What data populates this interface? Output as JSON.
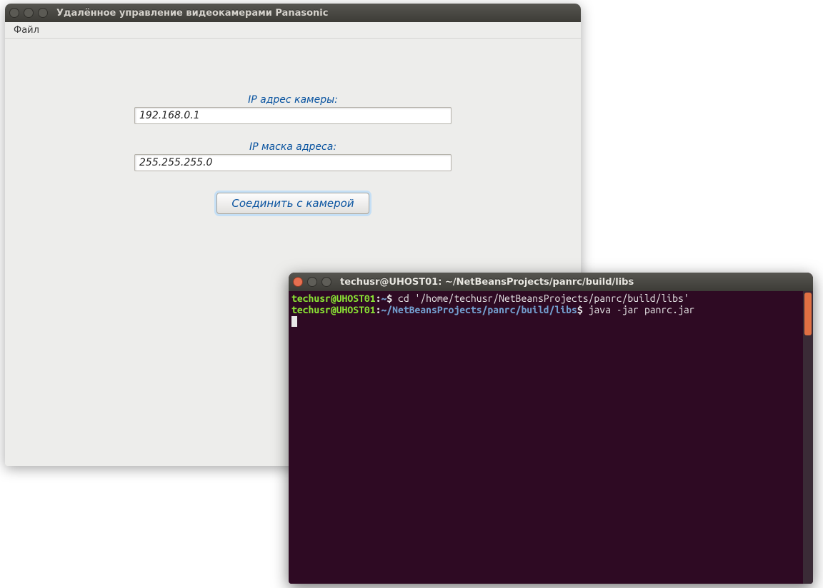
{
  "app_window": {
    "title": "Удалённое управление видеокамерами Panasonic",
    "menubar": {
      "file_label": "Файл"
    },
    "form": {
      "ip_label": "IP адрес камеры:",
      "ip_value": "192.168.0.1",
      "mask_label": "IP маска адреса:",
      "mask_value": "255.255.255.0",
      "connect_label": "Соединить с камерой"
    }
  },
  "terminal": {
    "title": "techusr@UHOST01: ~/NetBeansProjects/panrc/build/libs",
    "lines": [
      {
        "user": "techusr@UHOST01",
        "sep1": ":",
        "path": "~",
        "sep2": "$ ",
        "cmd": "cd '/home/techusr/NetBeansProjects/panrc/build/libs'"
      },
      {
        "user": "techusr@UHOST01",
        "sep1": ":",
        "path": "~/NetBeansProjects/panrc/build/libs",
        "sep2": "$ ",
        "cmd": "java -jar panrc.jar"
      }
    ]
  }
}
